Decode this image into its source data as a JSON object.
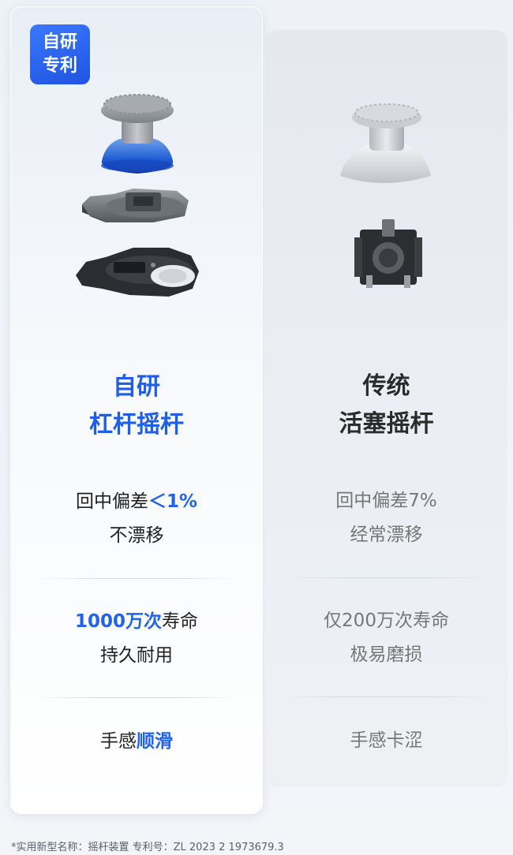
{
  "badge": {
    "line1": "自研",
    "line2": "专利"
  },
  "left": {
    "title_line1": "自研",
    "title_line2": "杠杆摇杆",
    "f1_prefix": "回中偏差",
    "f1_highlight": "＜1%",
    "f1_line2": "不漂移",
    "f2_highlight": "1000万次",
    "f2_suffix": "寿命",
    "f2_line2": "持久耐用",
    "f3_prefix": "手感",
    "f3_highlight": "顺滑"
  },
  "right": {
    "title_line1": "传统",
    "title_line2": "活塞摇杆",
    "f1_line1": "回中偏差7%",
    "f1_line2": "经常漂移",
    "f2_line1": "仅200万次寿命",
    "f2_line2": "极易磨损",
    "f3_line1": "手感卡涩"
  },
  "footnote": "*实用新型名称：摇杆装置 专利号：ZL 2023 2 1973679.3",
  "colors": {
    "accent": "#2263ee",
    "dark_text": "#222222",
    "muted_text": "#777777"
  }
}
